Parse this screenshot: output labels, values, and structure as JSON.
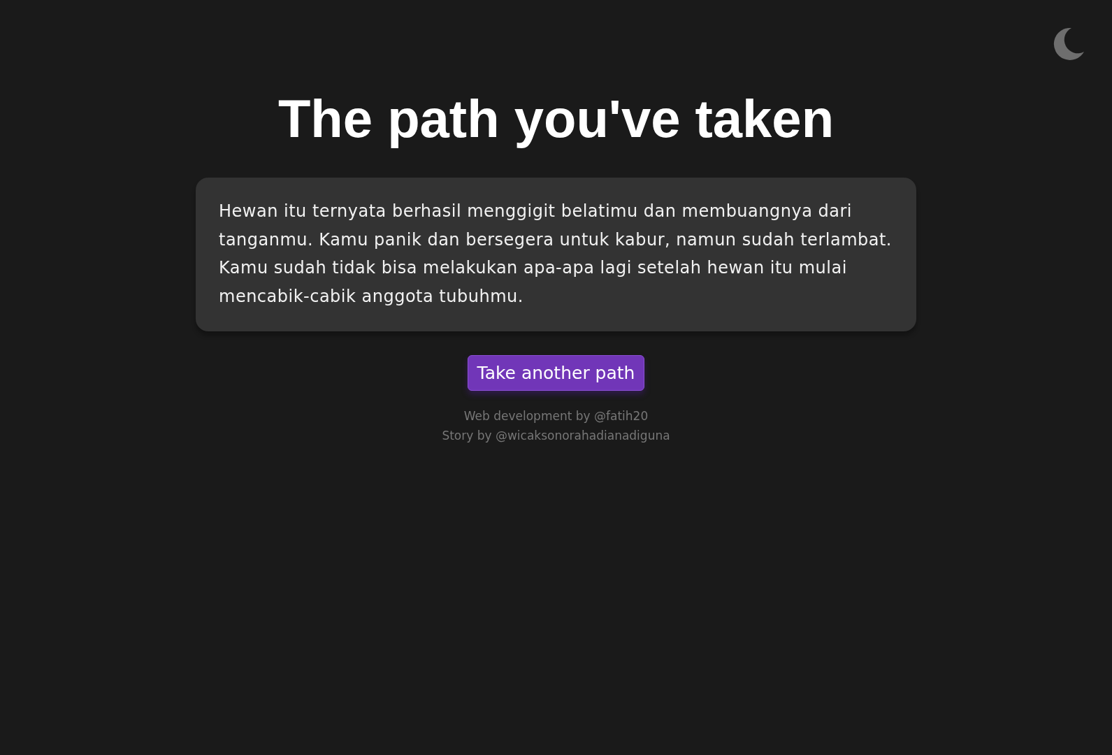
{
  "title": "The path you've taken",
  "story": "Hewan itu ternyata berhasil menggigit belatimu dan membuangnya dari tanganmu. Kamu panik dan bersegera untuk kabur, namun sudah terlambat. Kamu sudah tidak bisa melakukan apa-apa lagi setelah hewan itu mulai mencabik-cabik anggota tubuhmu.",
  "button": "Take another path",
  "credits": [
    "Web development by @fatih20",
    "Story by @wicaksonorahadianadiguna"
  ]
}
